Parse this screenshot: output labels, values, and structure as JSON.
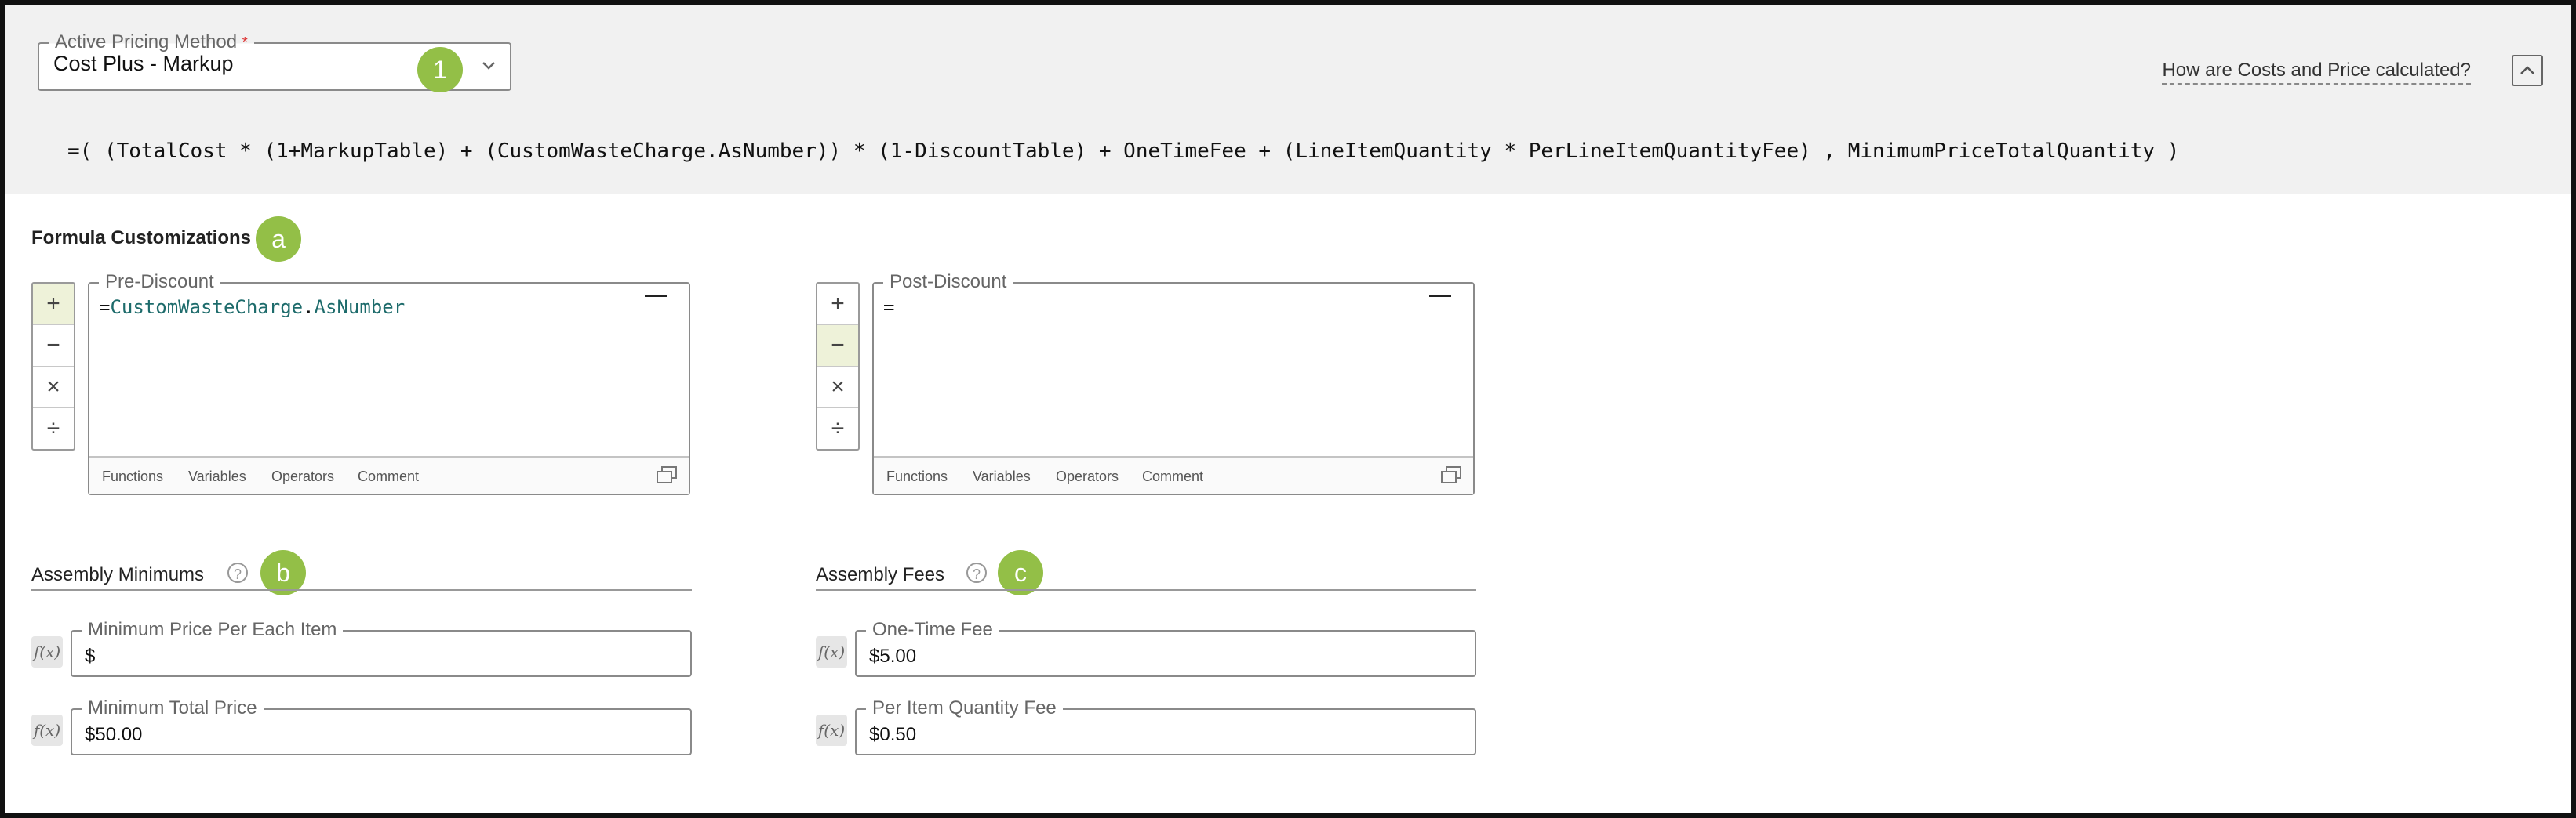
{
  "pricing": {
    "label": "Active Pricing Method",
    "required_mark": "*",
    "value": "Cost Plus - Markup",
    "badge": "1"
  },
  "help_link": "How are Costs and Price calculated?",
  "formula": "=( (TotalCost * (1+MarkupTable) + (CustomWasteCharge.AsNumber)) * (1-DiscountTable) + OneTimeFee + (LineItemQuantity * PerLineItemQuantityFee) , MinimumPriceTotalQuantity )",
  "customizations": {
    "title": "Formula Customizations",
    "badge": "a",
    "operators": [
      "+",
      "−",
      "×",
      "÷"
    ],
    "footer_links": [
      "Functions",
      "Variables",
      "Operators",
      "Comment"
    ],
    "pre_discount": {
      "label": "Pre-Discount",
      "prefix": "=",
      "var1": "CustomWasteCharge",
      "dot": ".",
      "var2": "AsNumber"
    },
    "post_discount": {
      "label": "Post-Discount",
      "prefix": "="
    }
  },
  "assembly_minimums": {
    "title": "Assembly Minimums",
    "badge": "b",
    "help": "?",
    "fx": "f(x)",
    "fields": [
      {
        "label": "Minimum Price Per Each Item",
        "value": "$"
      },
      {
        "label": "Minimum Total Price",
        "value": "$50.00"
      }
    ]
  },
  "assembly_fees": {
    "title": "Assembly Fees",
    "badge": "c",
    "help": "?",
    "fx": "f(x)",
    "fields": [
      {
        "label": "One-Time Fee",
        "value": "$5.00"
      },
      {
        "label": "Per Item Quantity Fee",
        "value": "$0.50"
      }
    ]
  },
  "colors": {
    "badge": "#93bf47",
    "active_op": "#eef2d9",
    "variable": "#1d6b6b"
  }
}
